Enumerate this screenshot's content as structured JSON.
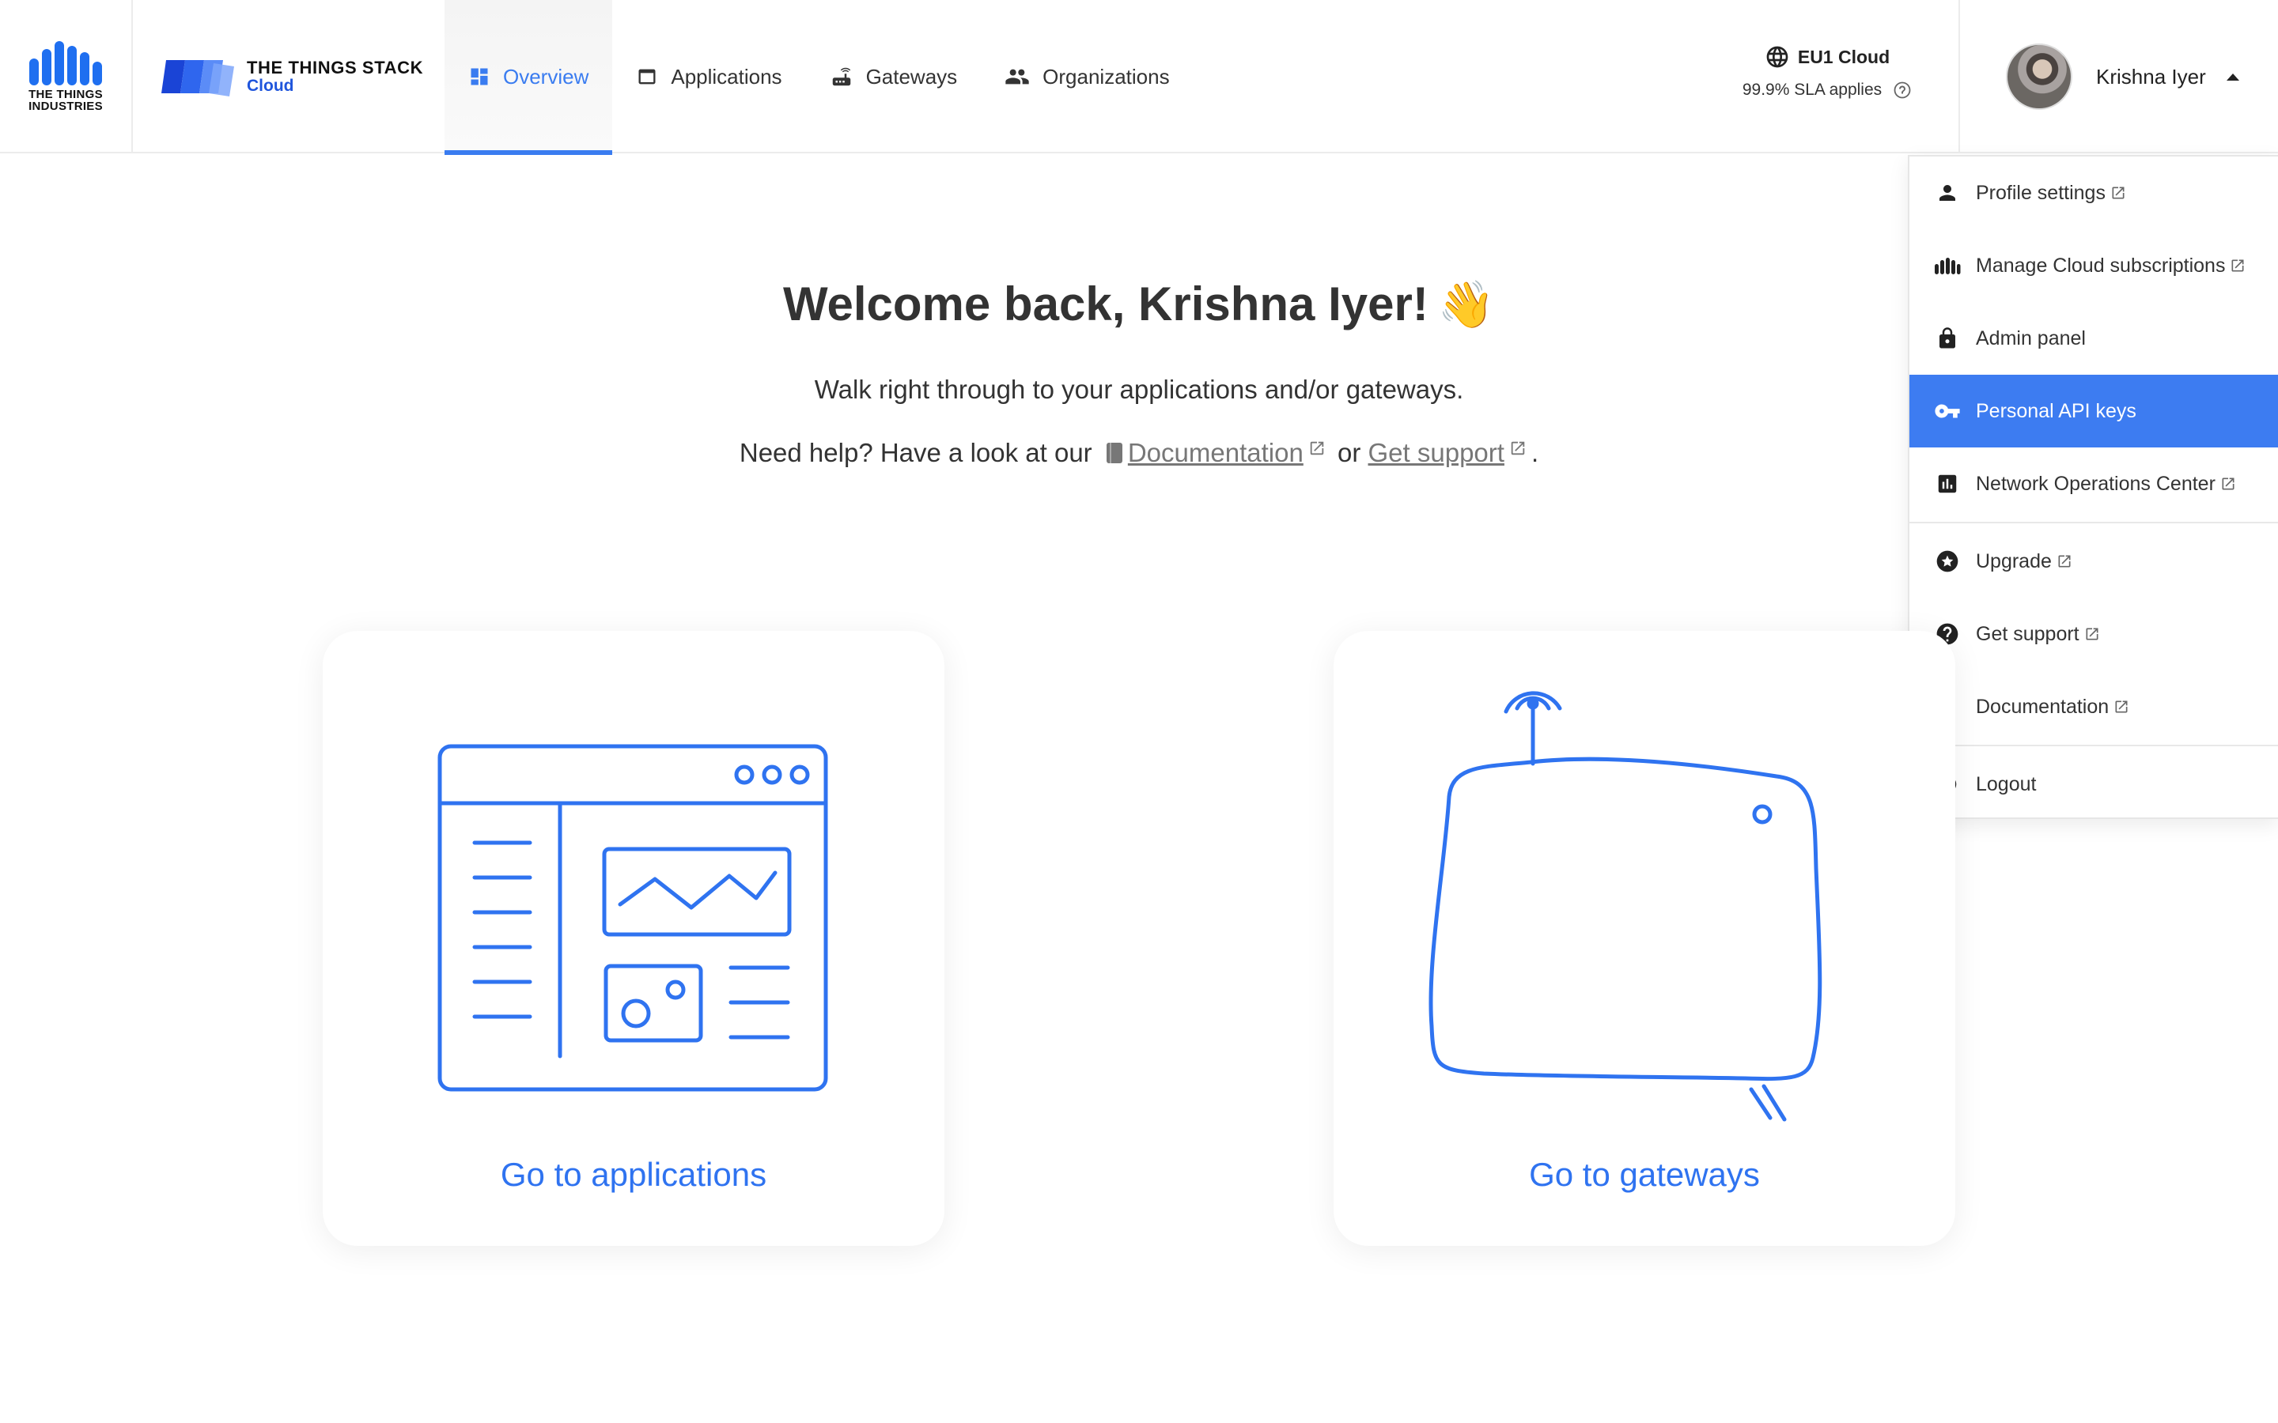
{
  "brand": {
    "company_logo_text": "THE THINGS INDUSTRIES",
    "product_name": "THE THINGS STACK",
    "product_sub": "Cloud"
  },
  "nav": {
    "items": [
      {
        "label": "Overview",
        "icon": "dashboard-icon",
        "active": true
      },
      {
        "label": "Applications",
        "icon": "window-icon",
        "active": false
      },
      {
        "label": "Gateways",
        "icon": "router-icon",
        "active": false
      },
      {
        "label": "Organizations",
        "icon": "people-icon",
        "active": false
      }
    ]
  },
  "cluster": {
    "name": "EU1 Cloud",
    "sla": "99.9% SLA applies"
  },
  "account": {
    "name": "Krishna Iyer"
  },
  "dropdown": {
    "items": [
      {
        "label": "Profile settings",
        "icon": "person-icon",
        "external": true
      },
      {
        "label": "Manage Cloud subscriptions",
        "icon": "bars-icon",
        "external": true
      },
      {
        "label": "Admin panel",
        "icon": "lock-icon",
        "external": false
      },
      {
        "label": "Personal API keys",
        "icon": "key-icon",
        "external": false,
        "active": true
      },
      {
        "label": "Network Operations Center",
        "icon": "chart-icon",
        "external": true
      },
      {
        "label": "Upgrade",
        "icon": "star-circle-icon",
        "external": true
      },
      {
        "label": "Get support",
        "icon": "help-circle-icon",
        "external": true
      },
      {
        "label": "Documentation",
        "icon": "document-icon",
        "external": true
      },
      {
        "label": "Logout",
        "icon": "power-icon",
        "external": false
      }
    ]
  },
  "welcome": {
    "title": "Welcome back, Krishna Iyer!",
    "wave": "👋",
    "subtitle": "Walk right through to your applications and/or gateways.",
    "help_prefix": "Need help? Have a look at our",
    "help_doc_link": "Documentation",
    "help_or": "or",
    "help_support_link": "Get support",
    "help_suffix": "."
  },
  "cards": {
    "applications_label": "Go to applications",
    "gateways_label": "Go to gateways"
  },
  "colors": {
    "accent": "#3a7cf0",
    "menu_active": "#3d7cf1",
    "brand_blue": "#1f55dc"
  }
}
